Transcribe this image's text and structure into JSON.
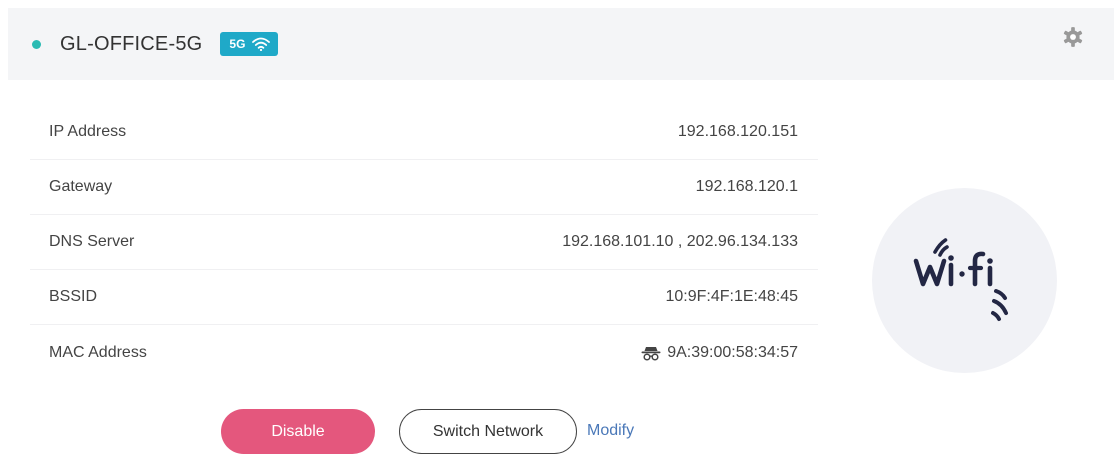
{
  "header": {
    "ssid": "GL-OFFICE-5G",
    "band_label": "5G",
    "status_color": "#2bbbb3",
    "badge_color": "#1fa9c8",
    "badge_icon": "wifi-icon",
    "settings_icon": "gear-icon"
  },
  "info": {
    "rows": [
      {
        "label": "IP Address",
        "value": "192.168.120.151"
      },
      {
        "label": "Gateway",
        "value": "192.168.120.1"
      },
      {
        "label": "DNS Server",
        "value": "192.168.101.10 , 202.96.134.133"
      },
      {
        "label": "BSSID",
        "value": "10:9F:4F:1E:48:45"
      },
      {
        "label": "MAC Address",
        "value": "9A:39:00:58:34:57",
        "icon": "incognito-icon"
      }
    ]
  },
  "illustration": {
    "icon": "wifi-logo-icon"
  },
  "actions": {
    "disable_label": "Disable",
    "switch_label": "Switch Network",
    "modify_label": "Modify",
    "disable_color": "#e4577d",
    "link_color": "#4a78b8"
  }
}
